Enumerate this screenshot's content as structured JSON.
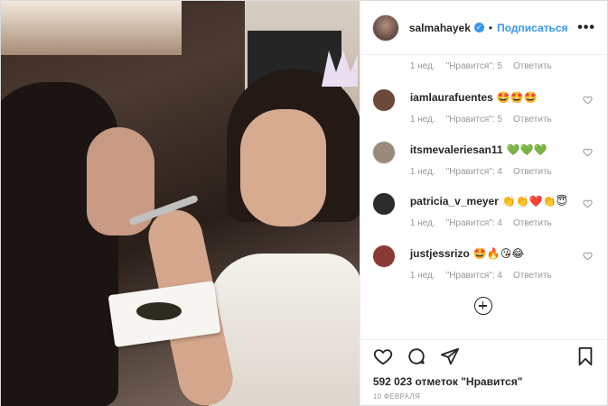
{
  "post": {
    "username": "salmahayek",
    "follow_label": "Подписаться",
    "dot": "•",
    "more": "•••",
    "first_meta": {
      "time": "1 нед.",
      "likes": "\"Нравится\": 5",
      "reply": "Ответить"
    },
    "comments": [
      {
        "user": "iamlaurafuentes",
        "text": "🤩🤩🤩",
        "time": "1 нед.",
        "likes": "\"Нравится\": 5",
        "reply": "Ответить",
        "avatar_color": "#6b4a3a"
      },
      {
        "user": "itsmevaleriesan11",
        "text": "💚💚💚",
        "time": "1 нед.",
        "likes": "\"Нравится\": 4",
        "reply": "Ответить",
        "avatar_color": "#9a8c7c"
      },
      {
        "user": "patricia_v_meyer",
        "text": "👏👏❤️👏😇",
        "time": "1 нед.",
        "likes": "\"Нравится\": 4",
        "reply": "Ответить",
        "avatar_color": "#2b2b2b"
      },
      {
        "user": "justjessrizo",
        "text": "🤩🔥😘😂",
        "time": "1 нед.",
        "likes": "\"Нравится\": 4",
        "reply": "Ответить",
        "avatar_color": "#8a3a34"
      }
    ],
    "likes_count": "592 023 отметок \"Нравится\"",
    "date": "10 февраля",
    "icons": [
      "heart-icon",
      "comment-icon",
      "share-icon",
      "bookmark-icon",
      "plus-circle-icon",
      "verified-icon"
    ]
  }
}
